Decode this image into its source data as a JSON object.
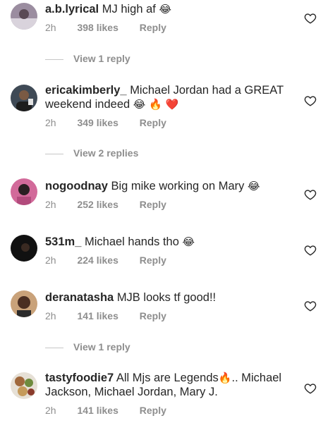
{
  "comments": [
    {
      "username": "a.b.lyrical",
      "text": "MJ high af",
      "emoji": "😂",
      "time": "2h",
      "likes": "398 likes",
      "reply": "Reply",
      "view_replies": "View 1 reply"
    },
    {
      "username": "ericakimberly_",
      "text": "Michael Jordan had a GREAT weekend indeed",
      "emoji": "😂 🔥 ❤️",
      "time": "2h",
      "likes": "349 likes",
      "reply": "Reply",
      "view_replies": "View 2 replies"
    },
    {
      "username": "nogoodnay",
      "text": "Big mike working on Mary",
      "emoji": "😂",
      "time": "2h",
      "likes": "252 likes",
      "reply": "Reply"
    },
    {
      "username": "531m_",
      "text": "Michael hands tho",
      "emoji": "😂",
      "time": "2h",
      "likes": "224 likes",
      "reply": "Reply"
    },
    {
      "username": "deranatasha",
      "text": "MJB looks tf good!!",
      "emoji": "",
      "time": "2h",
      "likes": "141 likes",
      "reply": "Reply",
      "view_replies": "View 1 reply"
    },
    {
      "username": "tastyfoodie7",
      "text": "All Mjs are Legends",
      "emoji": "🔥",
      "text_after": ".. Michael Jackson, Michael Jordan, Mary J.",
      "time": "2h",
      "likes": "141 likes",
      "reply": "Reply"
    }
  ],
  "icons": {
    "like": "heart-outline-icon"
  },
  "colors": {
    "meta_gray": "#8e8e8e",
    "text": "#262626"
  }
}
